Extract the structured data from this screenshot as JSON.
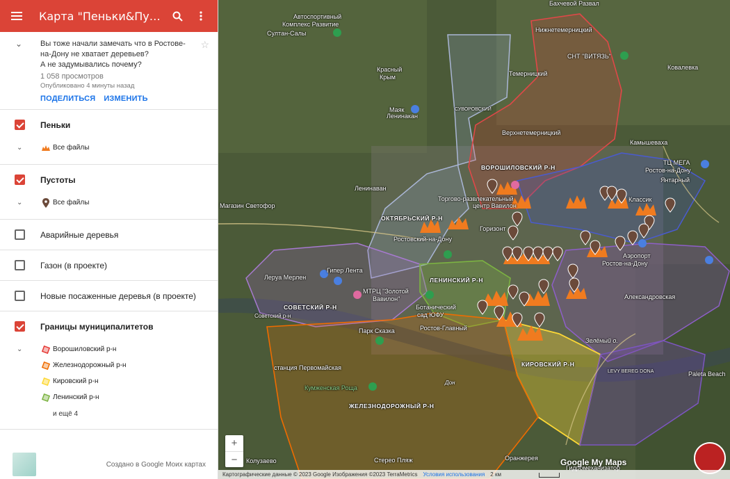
{
  "header": {
    "title": "Карта \"Пеньки&Пустоты…"
  },
  "description": {
    "line1": "Вы тоже начали замечать что в Ростове-на-Дону не хватает деревьев?",
    "line2": "А не задумывались почему?",
    "views": "1 058 просмотров",
    "published": "Опубликовано 4 минуты назад",
    "share": "ПОДЕЛИТЬСЯ",
    "edit": "ИЗМЕНИТЬ"
  },
  "layers": [
    {
      "name": "Пеньки",
      "checked": true,
      "sub": [
        {
          "label": "Все файлы",
          "icon": "stump-icon"
        }
      ]
    },
    {
      "name": "Пустоты",
      "checked": true,
      "sub": [
        {
          "label": "Все файлы",
          "icon": "pin-icon"
        }
      ]
    },
    {
      "name": "Аварийные деревья",
      "checked": false
    },
    {
      "name": "Газон (в проекте)",
      "checked": false
    },
    {
      "name": "Новые посаженные деревья (в проекте)",
      "checked": false
    },
    {
      "name": "Границы муниципалитетов",
      "checked": true,
      "sub": [
        {
          "label": "Ворошиловский р-н",
          "color": "#e53935"
        },
        {
          "label": "Железнодорожный р-н",
          "color": "#ef6c00"
        },
        {
          "label": "Кировский р-н",
          "color": "#fdd835"
        },
        {
          "label": "Ленинский р-н",
          "color": "#7cb342"
        }
      ],
      "more": "и ещё 4"
    }
  ],
  "footer": {
    "credit": "Создано в Google Моих картах"
  },
  "map": {
    "labels": {
      "l1": "Автоспортивный",
      "l1b": "Комплекс Развитие",
      "l2": "Бахчевой Развал",
      "l3": "Нижнетемерницкий",
      "l4": "Султан-Салы",
      "l5": "СНТ \"ВИТЯЗЬ\"",
      "l6": "Ковалевка",
      "l7": "Красный",
      "l7b": "Крым",
      "l8": "Темерницкий",
      "l9": "Маяк",
      "l10": "СУВОРОВСКИЙ",
      "l11": "Ленинакан",
      "l12": "Верхнетемерницкий",
      "l13": "Камышеваха",
      "l14": "ТЦ МЕГА",
      "l14b": "Ростов-на-Дону",
      "l15": "ВОРОШИЛОВСКИЙ Р-Н",
      "l16": "Ленинаван",
      "l17": "Янтарный",
      "l18": "Магазин Светофор",
      "l19": "Торгово-развлекательный",
      "l19b": "центр Вавилон",
      "l20": "Классик",
      "l21": "ОКТЯБРЬСКИЙ Р-Н",
      "l22": "Ростовский-на-Дону",
      "l23": "Горизонт",
      "l24": "Аэропорт",
      "l24b": "Ростов-на-Дону",
      "l25": "Леруа Мерлен",
      "l26": "Гипер Лента",
      "l27": "МТРЦ \"Золотой",
      "l27b": "Вавилон\"",
      "l28": "СОВЕТСКИЙ Р-Н",
      "l29": "ЛЕНИНСКИЙ Р-Н",
      "l30": "Александровская",
      "l31": "Ботанический",
      "l31b": "сад ЮФУ",
      "l32": "Ростов-Главный",
      "l33": "Парк Сказка",
      "l34": "Зелёный о.",
      "l35": "КИРОВСКИЙ Р-Н",
      "l36": "станция Первомайская",
      "l37": "Кумженская Роща",
      "l38": "ЖЕЛЕЗНОДОРОЖНЫЙ Р-Н",
      "l39": "Paleta Beach",
      "l40": "Колузаево",
      "l41": "Оранжерея",
      "l42": "Стерео Пляж",
      "l43": "Гидромеханизатор",
      "l44": "LEVY BEREG DONA",
      "l45": "Советский р-н",
      "l46": "Дон"
    },
    "attribution": "Картографические данные © 2023 Google Изображения ©2023 TerraMetrics",
    "terms": "Условия использования",
    "scale": "2 км",
    "logo": "Google My Maps",
    "zoom_in": "+",
    "zoom_out": "−"
  }
}
